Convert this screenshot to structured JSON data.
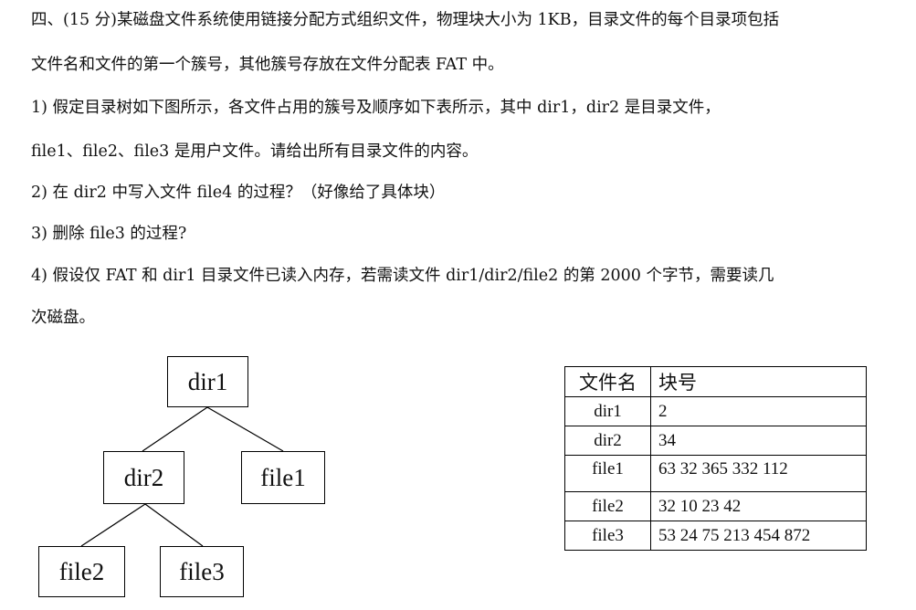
{
  "question": {
    "lines": [
      "四、(15 分)某磁盘文件系统使用链接分配方式组织文件，物理块大小为 1KB，目录文件的每个目录项包括",
      "文件名和文件的第一个簇号，其他簇号存放在文件分配表 FAT 中。",
      "1) 假定目录树如下图所示，各文件占用的簇号及顺序如下表所示，其中 dir1，dir2 是目录文件，",
      "file1、file2、file3 是用户文件。请给出所有目录文件的内容。",
      "2) 在 dir2 中写入文件 file4 的过程？（好像给了具体块）",
      "3) 删除 file3 的过程?",
      "4) 假设仅 FAT 和 dir1 目录文件已读入内存，若需读文件 dir1/dir2/file2 的第 2000 个字节，需要读几",
      "次磁盘。"
    ]
  },
  "tree": {
    "nodes": {
      "dir1": "dir1",
      "dir2": "dir2",
      "file1": "file1",
      "file2": "file2",
      "file3": "file3"
    }
  },
  "table": {
    "headers": [
      "文件名",
      "块号"
    ],
    "rows": [
      [
        "dir1",
        "2"
      ],
      [
        "dir2",
        "34"
      ],
      [
        "file1",
        "63 32 365 332 112"
      ],
      [
        "file2",
        "32 10 23 42"
      ],
      [
        "file3",
        "53 24 75 213 454 872"
      ]
    ]
  }
}
